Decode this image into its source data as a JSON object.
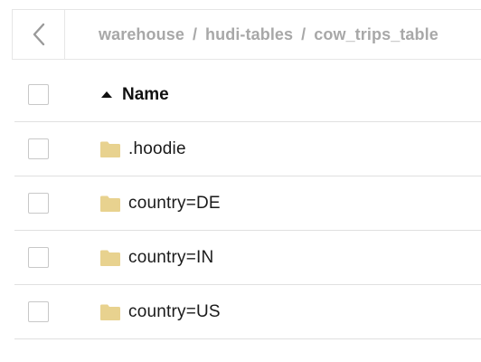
{
  "breadcrumb": {
    "items": [
      "warehouse",
      "hudi-tables",
      "cow_trips_table"
    ],
    "separator": "/"
  },
  "table": {
    "columns": [
      {
        "label": "Name",
        "sort": "ascending"
      }
    ],
    "rows": [
      {
        "name": ".hoodie",
        "type": "folder"
      },
      {
        "name": "country=DE",
        "type": "folder"
      },
      {
        "name": "country=IN",
        "type": "folder"
      },
      {
        "name": "country=US",
        "type": "folder"
      }
    ]
  },
  "colors": {
    "folder": "#e8d28f",
    "breadcrumb_text": "#a8a8a8",
    "divider": "#e0e0e0"
  }
}
